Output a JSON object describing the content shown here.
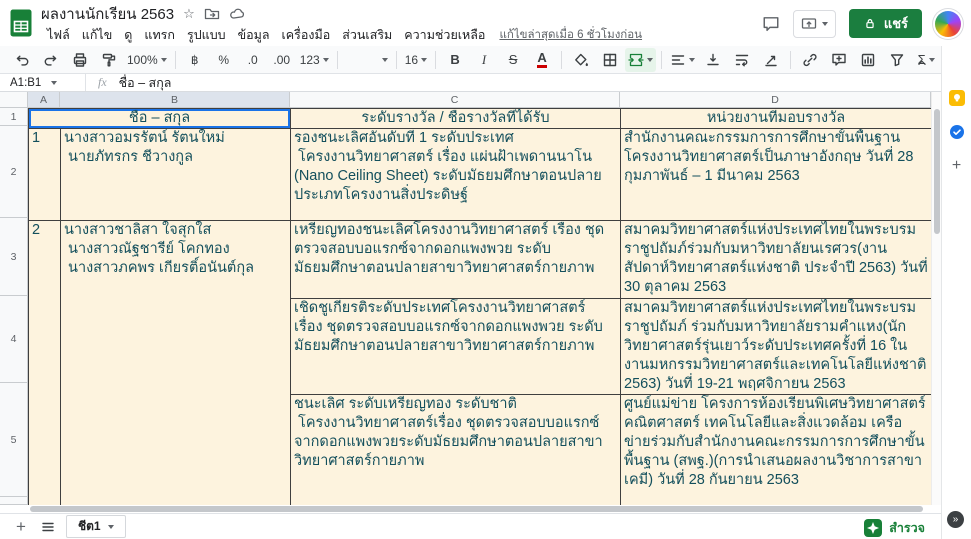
{
  "topbar": {
    "doc_title": "ผลงานนักเรียน 2563",
    "menus": [
      "ไฟล์",
      "แก้ไข",
      "ดู",
      "แทรก",
      "รูปแบบ",
      "ข้อมูล",
      "เครื่องมือ",
      "ส่วนเสริม",
      "ความช่วยเหลือ"
    ],
    "last_edit": "แก้ไขล่าสุดเมื่อ 6 ชั่วโมงก่อน",
    "share_label": "แชร์"
  },
  "toolbar": {
    "zoom": "100%",
    "currency": "฿",
    "percent": "%",
    "decrease_decimal": ".0",
    "increase_decimal": ".00",
    "more_formats": "123",
    "font_size": "16",
    "bold": "B",
    "italic": "I",
    "strikethrough": "S",
    "text_color": "A",
    "functions": "Σ"
  },
  "formula_bar": {
    "name_box": "A1:B1",
    "fx_label": "fx",
    "content": "ชื่อ – สกุล"
  },
  "grid": {
    "column_headers": [
      "A",
      "B",
      "C",
      "D"
    ],
    "row_headers": [
      "1",
      "2",
      "3",
      "4",
      "5"
    ]
  },
  "table": {
    "headers": {
      "name": "ชื่อ – สกุล",
      "award": "ระดับรางวัล / ชื่อรางวัลที่ได้รับ",
      "org": "หน่วยงานที่มอบรางวัล"
    },
    "entries": [
      {
        "no": "1",
        "names": "นางสาวอมรรัตน์ รัตนใหม่\n นายภัทรกร ชีวางกูล",
        "awards": [
          "รองชนะเลิศอันดับที่ 1 ระดับประเทศ\n โครงงานวิทยาศาสตร์ เรื่อง แผ่นฝ้าเพดานนาโน (Nano Ceiling Sheet) ระดับมัธยมศึกษาตอนปลาย ประเภทโครงงานสิ่งประดิษฐ์"
        ],
        "orgs": [
          "สำนักงานคณะกรรมการการศึกษาขั้นพื้นฐานโครงงานวิทยาศาสตร์เป็นภาษาอังกฤษ วันที่ 28 กุมภาพันธ์ – 1 มีนาคม 2563"
        ]
      },
      {
        "no": "2",
        "names": "นางสาวชาลิสา ใจสุกใส\n นางสาวณัฐชารีย์ โคกทอง\n นางสาวภคพร เกียรติ์อนันต์กุล",
        "awards": [
          "เหรียญทองชนะเลิศโครงงานวิทยาศาสตร์ เรื่อง ชุดตรวจสอบบอแรกซ์จากดอกแพงพวย ระดับมัธยมศึกษาตอนปลายสาขาวิทยาศาสตร์กายภาพ",
          "เชิดชูเกียรติระดับประเทศโครงงานวิทยาศาสตร์ เรื่อง ชุดตรวจสอบบอแรกซ์จากดอกแพงพวย ระดับมัธยมศึกษาตอนปลายสาขาวิทยาศาสตร์กายภาพ",
          "ชนะเลิศ ระดับเหรียญทอง ระดับชาติ\n โครงงานวิทยาศาสตร์เรื่อง ชุดตรวจสอบบอแรกซ์จากดอกแพงพวยระดับมัธยมศึกษาตอนปลายสาขาวิทยาศาสตร์กายภาพ"
        ],
        "orgs": [
          "สมาคมวิทยาศาสตร์แห่งประเทศไทยในพระบรมราชูปถัมภ์ร่วมกับมหาวิทยาลัยนเรศวร(งานสัปดาห์วิทยาศาสตร์แห่งชาติ ประจำปี 2563) วันที่ 30 ตุลาคม 2563",
          "สมาคมวิทยาศาสตร์แห่งประเทศไทยในพระบรมราชูปถัมภ์ ร่วมกับมหาวิทยาลัยรามคำแหง(นักวิทยาศาสตร์รุ่นเยาว์ระดับประเทศครั้งที่ 16 ในงานมหกรรมวิทยาศาสตร์และเทคโนโลยีแห่งชาติ 2563) วันที่ 19-21 พฤศจิกายน 2563",
          "ศูนย์แม่ข่าย โครงการห้องเรียนพิเศษวิทยาศาสตร์ คณิตศาสตร์ เทคโนโลยีและสิ่งแวดล้อม เครือข่ายร่วมกับสำนักงานคณะกรรมการการศึกษาขั้นพื้นฐาน (สพฐ.)(การนำเสนอผลงานวิชาการสาขาเคมี) วันที่ 28 กันยายน 2563"
        ]
      }
    ]
  },
  "sheet_bar": {
    "active_tab": "ชีต1",
    "explore_label": "สำรวจ"
  },
  "colors": {
    "logo_green": "#188038",
    "share_button_green": "#1b7e3f",
    "cell_background": "#fdf3de",
    "cell_text": "#134f5c",
    "selection_blue": "#1a73e8",
    "merge_active_bg": "#e6f4ea",
    "explore_green": "#188038"
  }
}
